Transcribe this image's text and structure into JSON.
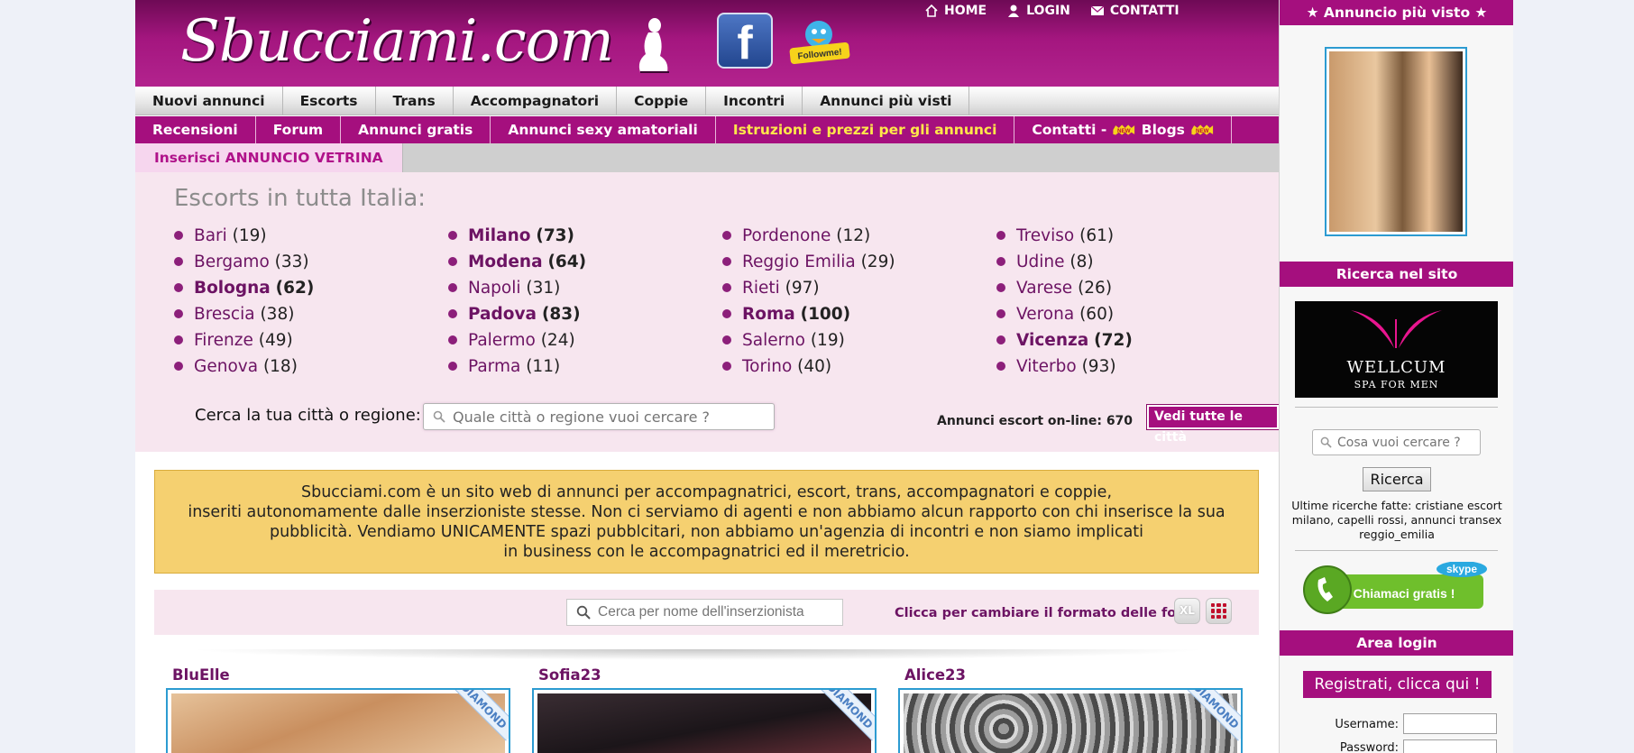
{
  "header": {
    "logo_text": "Sbucciami.com",
    "facebook_label": "f",
    "twitter_label": "Followme!",
    "top_nav": [
      {
        "label": "HOME",
        "icon": "home-icon"
      },
      {
        "label": "LOGIN",
        "icon": "user-icon"
      },
      {
        "label": "CONTATTI",
        "icon": "mail-icon"
      }
    ]
  },
  "nav1": [
    "Nuovi annunci",
    "Escorts",
    "Trans",
    "Accompagnatori",
    "Coppie",
    "Incontri",
    "Annunci più visti"
  ],
  "nav2": {
    "recensioni": "Recensioni",
    "forum": "Forum",
    "annunci_gratis": "Annunci gratis",
    "annunci_sexy": "Annunci sexy amatoriali",
    "istruzioni": "Istruzioni e prezzi per gli annunci",
    "contatti": "Contatti -",
    "blogs": "Blogs",
    "new_badge": "NEW"
  },
  "nav3": {
    "vetrina": "Inserisci ANNUNCIO VETRINA"
  },
  "cities": {
    "title": "Escorts in tutta Italia:",
    "columns": [
      [
        {
          "name": "Bari",
          "count": "(19)",
          "bold": false
        },
        {
          "name": "Bergamo",
          "count": "(33)",
          "bold": false
        },
        {
          "name": "Bologna",
          "count": "(62)",
          "bold": true
        },
        {
          "name": "Brescia",
          "count": "(38)",
          "bold": false
        },
        {
          "name": "Firenze",
          "count": "(49)",
          "bold": false
        },
        {
          "name": "Genova",
          "count": "(18)",
          "bold": false
        }
      ],
      [
        {
          "name": "Milano",
          "count": "(73)",
          "bold": true
        },
        {
          "name": "Modena",
          "count": "(64)",
          "bold": true
        },
        {
          "name": "Napoli",
          "count": "(31)",
          "bold": false
        },
        {
          "name": "Padova",
          "count": "(83)",
          "bold": true
        },
        {
          "name": "Palermo",
          "count": "(24)",
          "bold": false
        },
        {
          "name": "Parma",
          "count": "(11)",
          "bold": false
        }
      ],
      [
        {
          "name": "Pordenone",
          "count": "(12)",
          "bold": false
        },
        {
          "name": "Reggio Emilia",
          "count": "(29)",
          "bold": false
        },
        {
          "name": "Rieti",
          "count": "(97)",
          "bold": false
        },
        {
          "name": "Roma",
          "count": "(100)",
          "bold": true
        },
        {
          "name": "Salerno",
          "count": "(19)",
          "bold": false
        },
        {
          "name": "Torino",
          "count": "(40)",
          "bold": false
        }
      ],
      [
        {
          "name": "Treviso",
          "count": "(61)",
          "bold": false
        },
        {
          "name": "Udine",
          "count": "(8)",
          "bold": false
        },
        {
          "name": "Varese",
          "count": "(26)",
          "bold": false
        },
        {
          "name": "Verona",
          "count": "(60)",
          "bold": false
        },
        {
          "name": "Vicenza",
          "count": "(72)",
          "bold": true
        },
        {
          "name": "Viterbo",
          "count": "(93)",
          "bold": false
        }
      ]
    ],
    "search_label": "Cerca la tua città o regione:",
    "search_placeholder": "Quale città o regione vuoi cercare ?",
    "online_text": "Annunci escort on-line: 670",
    "all_cities_button": "Vedi tutte le città"
  },
  "disclaimer": [
    "Sbucciami.com è un sito web di annunci per accompagnatrici, escort, trans, accompagnatori e coppie,",
    "inseriti autonomamente dalle inserzioniste stesse. Non ci serviamo di agenti e non abbiamo alcun rapporto con chi inserisce la sua",
    "pubblicità. Vendiamo UNICAMENTE spazi pubblcitari, non abbiamo un'agenzia di incontri e non siamo implicati",
    "in business con le accompagnatrici ed il meretricio."
  ],
  "filter": {
    "name_search_placeholder": "Cerca per nome dell'inserzionista",
    "format_label": "Clicca per cambiare il formato delle foto",
    "xl_button": "XL"
  },
  "listings": [
    {
      "name": "BluElle",
      "badge": "DIAMOND"
    },
    {
      "name": "Sofia23",
      "badge": "DIAMOND"
    },
    {
      "name": "Alice23",
      "badge": "DIAMOND"
    }
  ],
  "sidebar": {
    "most_viewed_title": "Annuncio più visto",
    "search_title": "Ricerca nel sito",
    "wellcum_title": "WELLCUM",
    "wellcum_sub": "SPA FOR MEN",
    "search_placeholder": "Cosa vuoi cercare ?",
    "search_button": "Ricerca",
    "recent_searches": "Ultime ricerche fatte: cristiane escort milano, capelli rossi, annunci transex reggio_emilia",
    "skype_brand": "skype",
    "skype_text": "Chiamaci gratis !",
    "login_title": "Area login",
    "register_button": "Registrati, clicca qui !",
    "username_label": "Username:",
    "password_label": "Password:"
  },
  "colors": {
    "brand_magenta": "#a50f7e",
    "disclaimer_bg": "#f5d070",
    "panel_pink": "#f7e6ef",
    "highlight_yellow": "#ffe74a",
    "frame_blue": "#2c9bd1"
  }
}
